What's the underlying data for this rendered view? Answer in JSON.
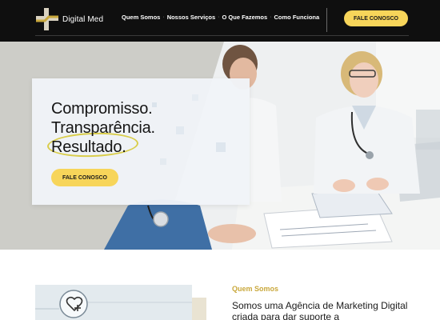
{
  "header": {
    "brand": "Digital Med",
    "nav": [
      "Quem Somos",
      "Nossos Serviços",
      "O Que Fazemos",
      "Como Funciona"
    ],
    "cta": "FALE CONOSCO"
  },
  "hero": {
    "headline": [
      "Compromisso.",
      "Transparência.",
      "Resultado."
    ],
    "cta": "FALE CONOSCO"
  },
  "about": {
    "label": "Quem Somos",
    "text": "Somos uma Agência de Marketing Digital criada para dar suporte a"
  },
  "colors": {
    "accent": "#f7d55a",
    "header_bg": "#0f0f0f",
    "gold": "#c9a83c"
  },
  "icons": [
    "cross-logo-icon",
    "heart-plus-icon"
  ]
}
